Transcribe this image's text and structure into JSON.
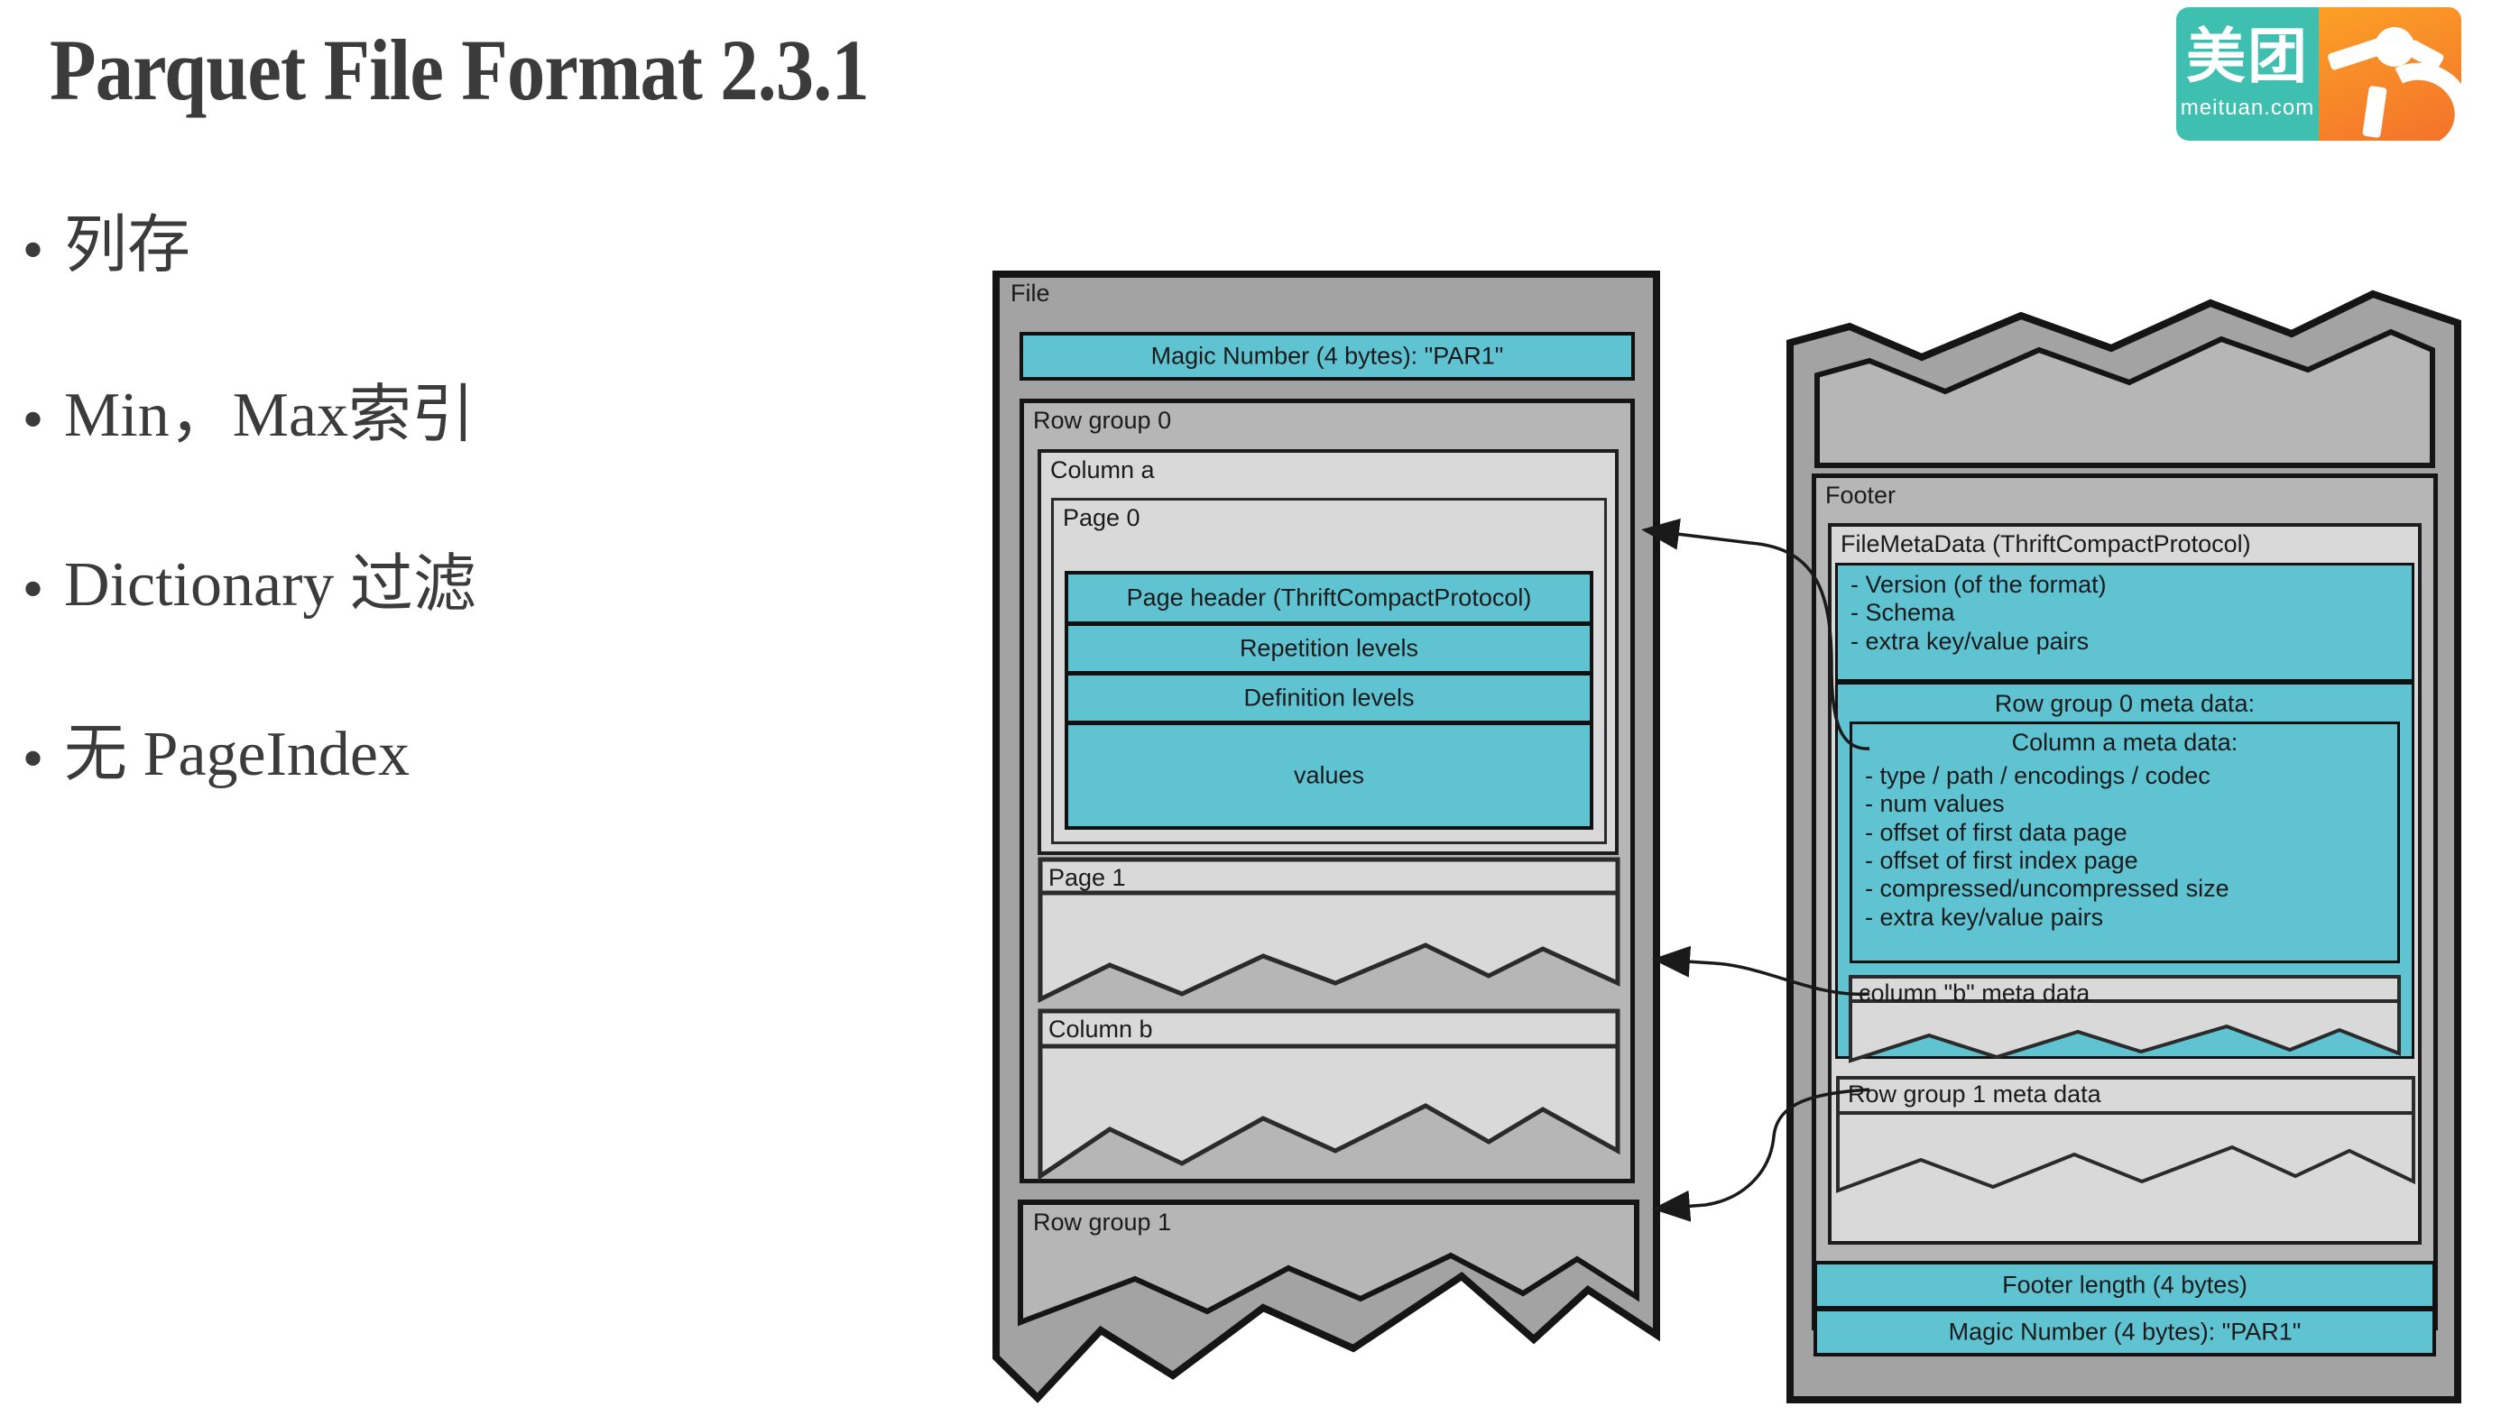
{
  "slide": {
    "title": "Parquet File Format 2.3.1"
  },
  "logo": {
    "name": "meituan-logo",
    "chinese": "美团",
    "url": "meituan.com",
    "teal_hex": "#3ebfb0",
    "orange_hex": "#f4722b"
  },
  "bullets": [
    {
      "marker": "•",
      "text": "列存"
    },
    {
      "marker": "•",
      "text": "Min，Max索引"
    },
    {
      "marker": "•",
      "text": "Dictionary 过滤"
    },
    {
      "marker": "•",
      "text": "无 PageIndex"
    }
  ],
  "colors": {
    "teal": "#5fc3d2",
    "gray_outer": "#a3a3a3",
    "gray_mid": "#b6b6b6",
    "gray_light": "#d9d9d9",
    "outline": "#151515",
    "title_text": "#3b3b3b"
  },
  "diagram": {
    "file_panel": {
      "label": "File",
      "magic_number": "Magic Number (4 bytes): \"PAR1\"",
      "row_group_0": {
        "label": "Row group 0",
        "column_a": {
          "label": "Column a",
          "page_0": {
            "label": "Page 0",
            "page_header": "Page header (ThriftCompactProtocol)",
            "repetition_levels": "Repetition levels",
            "definition_levels": "Definition levels",
            "values": "values"
          },
          "page_1": {
            "label": "Page 1"
          }
        },
        "column_b": {
          "label": "Column b"
        }
      },
      "row_group_1": {
        "label": "Row group 1"
      }
    },
    "footer_panel": {
      "label": "Footer",
      "file_meta_data": {
        "label": "FileMetaData (ThriftCompactProtocol)",
        "items": [
          "- Version (of the format)",
          "- Schema",
          "- extra key/value pairs"
        ],
        "row_group_0_meta": {
          "label": "Row group 0 meta data:",
          "column_a_meta": {
            "label": "Column a meta data:",
            "items": [
              "- type / path / encodings /  codec",
              "- num values",
              "- offset of first data page",
              "- offset of first index page",
              "- compressed/uncompressed size",
              "- extra key/value pairs"
            ]
          },
          "column_b_meta": {
            "label": "column \"b\" meta data"
          }
        },
        "row_group_1_meta": {
          "label": "Row group 1 meta data"
        }
      },
      "footer_length": "Footer length (4 bytes)",
      "magic_number": "Magic Number (4 bytes): \"PAR1\""
    },
    "connectors": [
      {
        "name": "page-header-connector",
        "from": "Column a meta data",
        "to": "Page 0 header"
      },
      {
        "name": "column-b-connector",
        "from": "column \"b\" meta data",
        "to": "Column b"
      },
      {
        "name": "row-group-1-connector",
        "from": "Row group 1 meta data",
        "to": "Row group 1"
      }
    ]
  }
}
